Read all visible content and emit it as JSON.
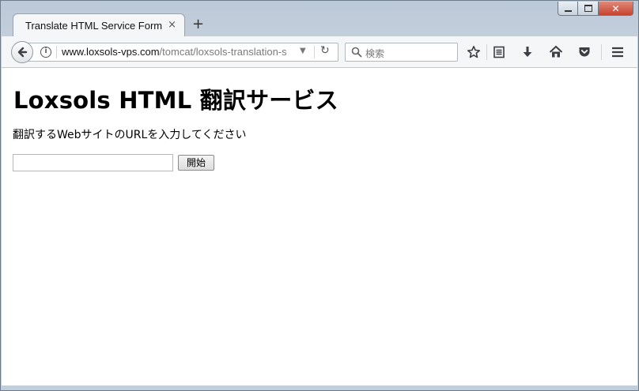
{
  "window": {
    "caption_buttons": [
      "minimize",
      "maximize",
      "close"
    ]
  },
  "tab": {
    "title": "Translate HTML Service Form",
    "close_glyph": "×",
    "new_tab_glyph": "+"
  },
  "toolbar": {
    "url_host": "www.loxsols-vps.com",
    "url_path": "/tomcat/loxsols-translation-s",
    "search_placeholder": "検索",
    "icons": [
      "back-icon",
      "info-icon",
      "dropdown-icon",
      "reload-icon",
      "search-icon",
      "bookmark-star-icon",
      "reading-list-icon",
      "download-icon",
      "home-icon",
      "pocket-icon",
      "menu-icon"
    ]
  },
  "page": {
    "title": "Loxsols HTML 翻訳サービス",
    "instruction": "翻訳するWebサイトのURLを入力してください",
    "url_input_value": "",
    "start_button": "開始"
  },
  "colors": {
    "window_frame": "#bcc9d8",
    "close_button": "#c7432e",
    "toolbar": "#f5f6f7"
  }
}
